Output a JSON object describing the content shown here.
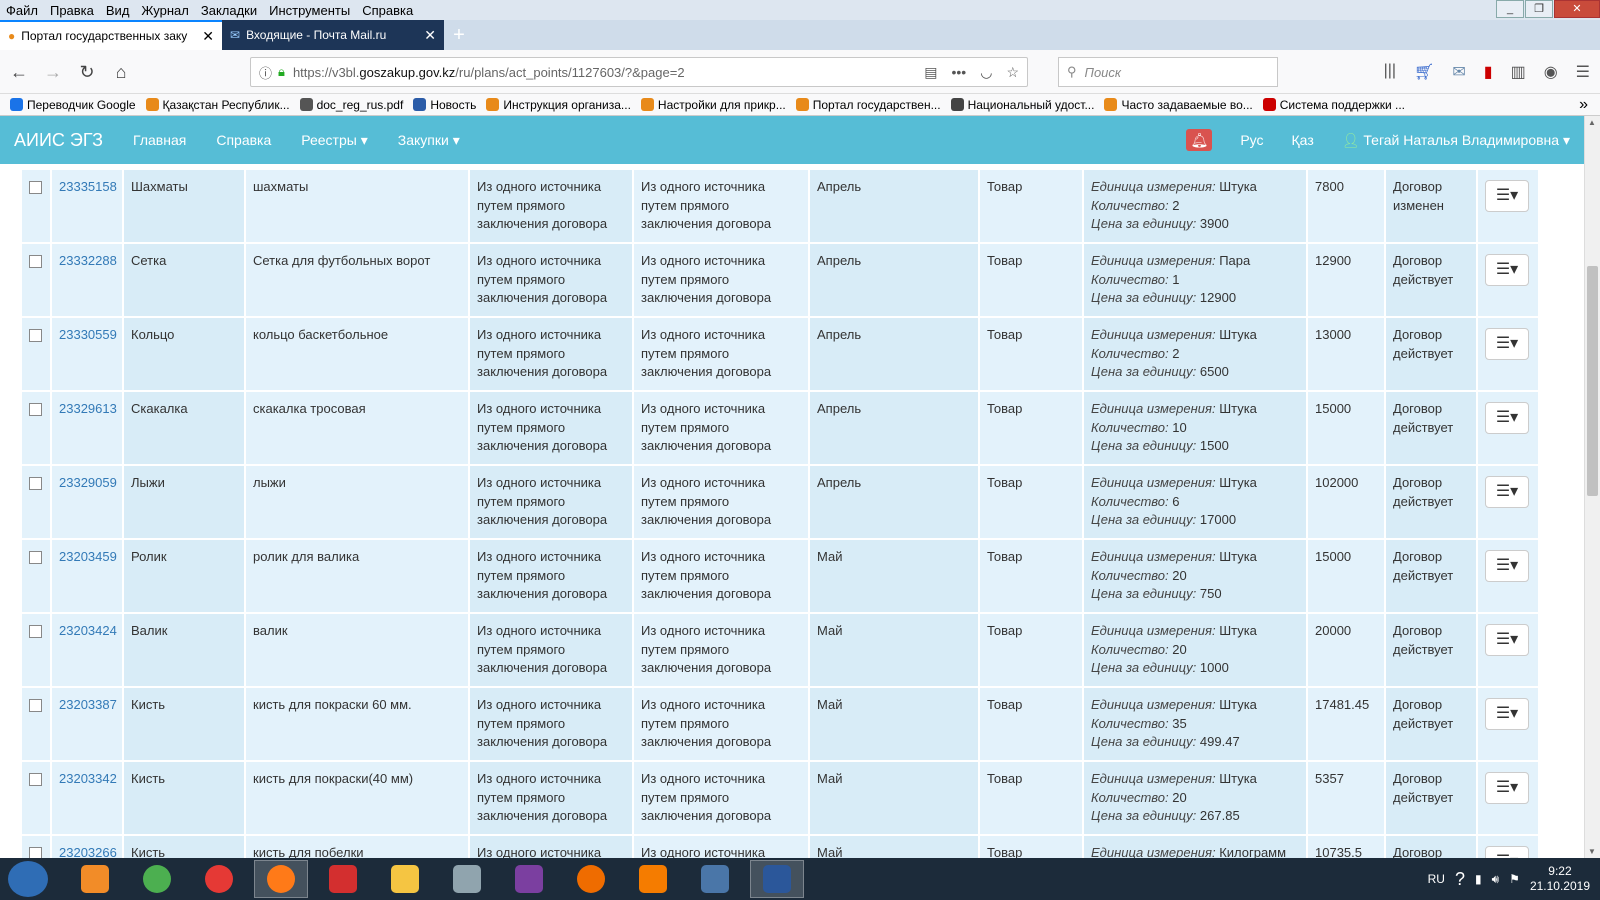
{
  "menu": [
    "Файл",
    "Правка",
    "Вид",
    "Журнал",
    "Закладки",
    "Инструменты",
    "Справка"
  ],
  "tabs": [
    {
      "title": "Портал государственных заку",
      "active": true
    },
    {
      "title": "Входящие - Почта Mail.ru",
      "active": false
    }
  ],
  "url": {
    "prefix": "https://v3bl.",
    "domain": "goszakup.gov.kz",
    "path": "/ru/plans/act_points/1127603/?&page=2"
  },
  "search_placeholder": "Поиск",
  "bookmarks": [
    "Переводчик Google",
    "Қазақстан Республик...",
    "doc_reg_rus.pdf",
    "Новость",
    "Инструкция организа...",
    "Настройки для прикр...",
    "Портал государствен...",
    "Национальный удост...",
    "Часто задаваемые во...",
    "Система поддержки ..."
  ],
  "app": {
    "brand": "АИИС ЭГЗ",
    "nav": [
      "Главная",
      "Справка",
      "Реестры ▾",
      "Закупки ▾"
    ],
    "lang_ru": "Рус",
    "lang_kz": "Қаз",
    "user": "Тегай Наталья Владимировна ▾"
  },
  "labels": {
    "unit": "Единица измерения:",
    "qty": "Количество:",
    "price": "Цена за единицу:"
  },
  "rows": [
    {
      "id": "23335158",
      "name": "Шахматы",
      "desc": "шахматы",
      "m1": "Из одного источника путем прямого заключения договора",
      "m2": "Из одного источника путем прямого заключения договора",
      "month": "Апрель",
      "type": "Товар",
      "unit": "Штука",
      "qty": "2",
      "price": "3900",
      "sum": "7800",
      "status": "Договор изменен"
    },
    {
      "id": "23332288",
      "name": "Сетка",
      "desc": "Сетка для футбольных ворот",
      "m1": "Из одного источника путем прямого заключения договора",
      "m2": "Из одного источника путем прямого заключения договора",
      "month": "Апрель",
      "type": "Товар",
      "unit": "Пара",
      "qty": "1",
      "price": "12900",
      "sum": "12900",
      "status": "Договор действует"
    },
    {
      "id": "23330559",
      "name": "Кольцо",
      "desc": "кольцо баскетбольное",
      "m1": "Из одного источника путем прямого заключения договора",
      "m2": "Из одного источника путем прямого заключения договора",
      "month": "Апрель",
      "type": "Товар",
      "unit": "Штука",
      "qty": "2",
      "price": "6500",
      "sum": "13000",
      "status": "Договор действует"
    },
    {
      "id": "23329613",
      "name": "Скакалка",
      "desc": "скакалка тросовая",
      "m1": "Из одного источника путем прямого заключения договора",
      "m2": "Из одного источника путем прямого заключения договора",
      "month": "Апрель",
      "type": "Товар",
      "unit": "Штука",
      "qty": "10",
      "price": "1500",
      "sum": "15000",
      "status": "Договор действует"
    },
    {
      "id": "23329059",
      "name": "Лыжи",
      "desc": "лыжи",
      "m1": "Из одного источника путем прямого заключения договора",
      "m2": "Из одного источника путем прямого заключения договора",
      "month": "Апрель",
      "type": "Товар",
      "unit": "Штука",
      "qty": "6",
      "price": "17000",
      "sum": "102000",
      "status": "Договор действует"
    },
    {
      "id": "23203459",
      "name": "Ролик",
      "desc": "ролик для валика",
      "m1": "Из одного источника путем прямого заключения договора",
      "m2": "Из одного источника путем прямого заключения договора",
      "month": "Май",
      "type": "Товар",
      "unit": "Штука",
      "qty": "20",
      "price": "750",
      "sum": "15000",
      "status": "Договор действует"
    },
    {
      "id": "23203424",
      "name": "Валик",
      "desc": "валик",
      "m1": "Из одного источника путем прямого заключения договора",
      "m2": "Из одного источника путем прямого заключения договора",
      "month": "Май",
      "type": "Товар",
      "unit": "Штука",
      "qty": "20",
      "price": "1000",
      "sum": "20000",
      "status": "Договор действует"
    },
    {
      "id": "23203387",
      "name": "Кисть",
      "desc": "кисть для покраски 60 мм.",
      "m1": "Из одного источника путем прямого заключения договора",
      "m2": "Из одного источника путем прямого заключения договора",
      "month": "Май",
      "type": "Товар",
      "unit": "Штука",
      "qty": "35",
      "price": "499.47",
      "sum": "17481.45",
      "status": "Договор действует"
    },
    {
      "id": "23203342",
      "name": "Кисть",
      "desc": "кисть для покраски(40 мм)",
      "m1": "Из одного источника путем прямого заключения договора",
      "m2": "Из одного источника путем прямого заключения договора",
      "month": "Май",
      "type": "Товар",
      "unit": "Штука",
      "qty": "20",
      "price": "267.85",
      "sum": "5357",
      "status": "Договор действует"
    },
    {
      "id": "23203266",
      "name": "Кисть",
      "desc": "кисть для побелки",
      "m1": "Из одного источника",
      "m2": "Из одного источника",
      "month": "Май",
      "type": "Товар",
      "unit": "Килограмм",
      "qty": "",
      "price": "",
      "sum": "10735.5",
      "status": "Договор"
    }
  ],
  "taskbar": {
    "lang": "RU",
    "time": "9:22",
    "date": "21.10.2019"
  }
}
